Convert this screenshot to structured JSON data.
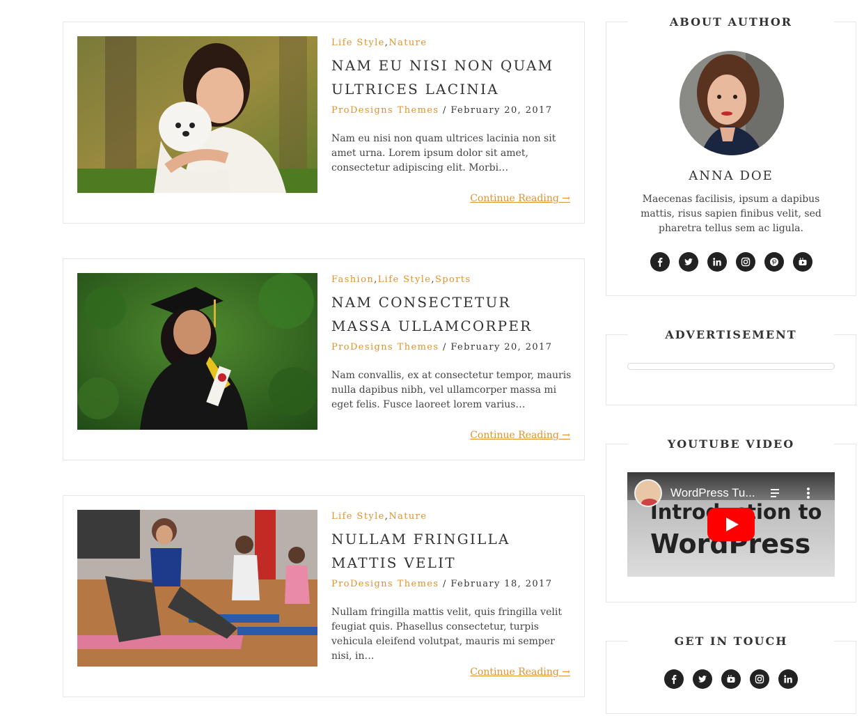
{
  "posts": [
    {
      "categories": [
        "Life Style",
        "Nature"
      ],
      "title": "NAM EU NISI NON QUAM ULTRICES LACINIA",
      "author": "ProDesigns Themes",
      "separator": "/",
      "date": "February 20, 2017",
      "excerpt": "Nam eu nisi non quam ultrices lacinia non sit amet urna. Lorem ipsum dolor sit amet, consectetur adipiscing elit. Morbi…",
      "read_more": "Continue Reading →"
    },
    {
      "categories": [
        "Fashion",
        "Life Style",
        "Sports"
      ],
      "title": "NAM CONSECTETUR MASSA ULLAMCORPER",
      "author": "ProDesigns Themes",
      "separator": "/",
      "date": "February 20, 2017",
      "excerpt": "Nam convallis, ex at consectetur tempor, mauris nulla dapibus nibh, vel ullamcorper massa mi eget felis. Fusce laoreet lorem varius…",
      "read_more": "Continue Reading →"
    },
    {
      "categories": [
        "Life Style",
        "Nature"
      ],
      "title": "NULLAM FRINGILLA MATTIS VELIT",
      "author": "ProDesigns Themes",
      "separator": "/",
      "date": "February 18, 2017",
      "excerpt": "Nullam fringilla mattis velit, quis fringilla velit feugiat quis. Phasellus consectetur, turpis vehicula eleifend volutpat, mauris mi semper nisi, in…",
      "read_more": "Continue Reading →"
    }
  ],
  "sidebar": {
    "about": {
      "title": "ABOUT AUTHOR",
      "name": "ANNA DOE",
      "bio": "Maecenas facilisis, ipsum a dapibus mattis, risus sapien finibus velit, sed pharetra tellus sem ac ligula.",
      "social_icons": [
        "facebook-icon",
        "twitter-icon",
        "linkedin-icon",
        "instagram-icon",
        "pinterest-icon",
        "youtube-icon"
      ]
    },
    "advertisement": {
      "title": "ADVERTISEMENT"
    },
    "youtube": {
      "title": "YOUTUBE VIDEO",
      "video_title": "WordPress Tu...",
      "overlay_line1": "Introduction to",
      "overlay_line2": "WordPress"
    },
    "get_in_touch": {
      "title": "GET IN TOUCH",
      "social_icons": [
        "facebook-icon",
        "twitter-icon",
        "youtube-icon",
        "instagram-icon",
        "linkedin-icon"
      ]
    }
  },
  "colors": {
    "accent": "#e0912c",
    "text": "#333333",
    "border": "#e6e6e6",
    "icon_bg": "#222222"
  }
}
